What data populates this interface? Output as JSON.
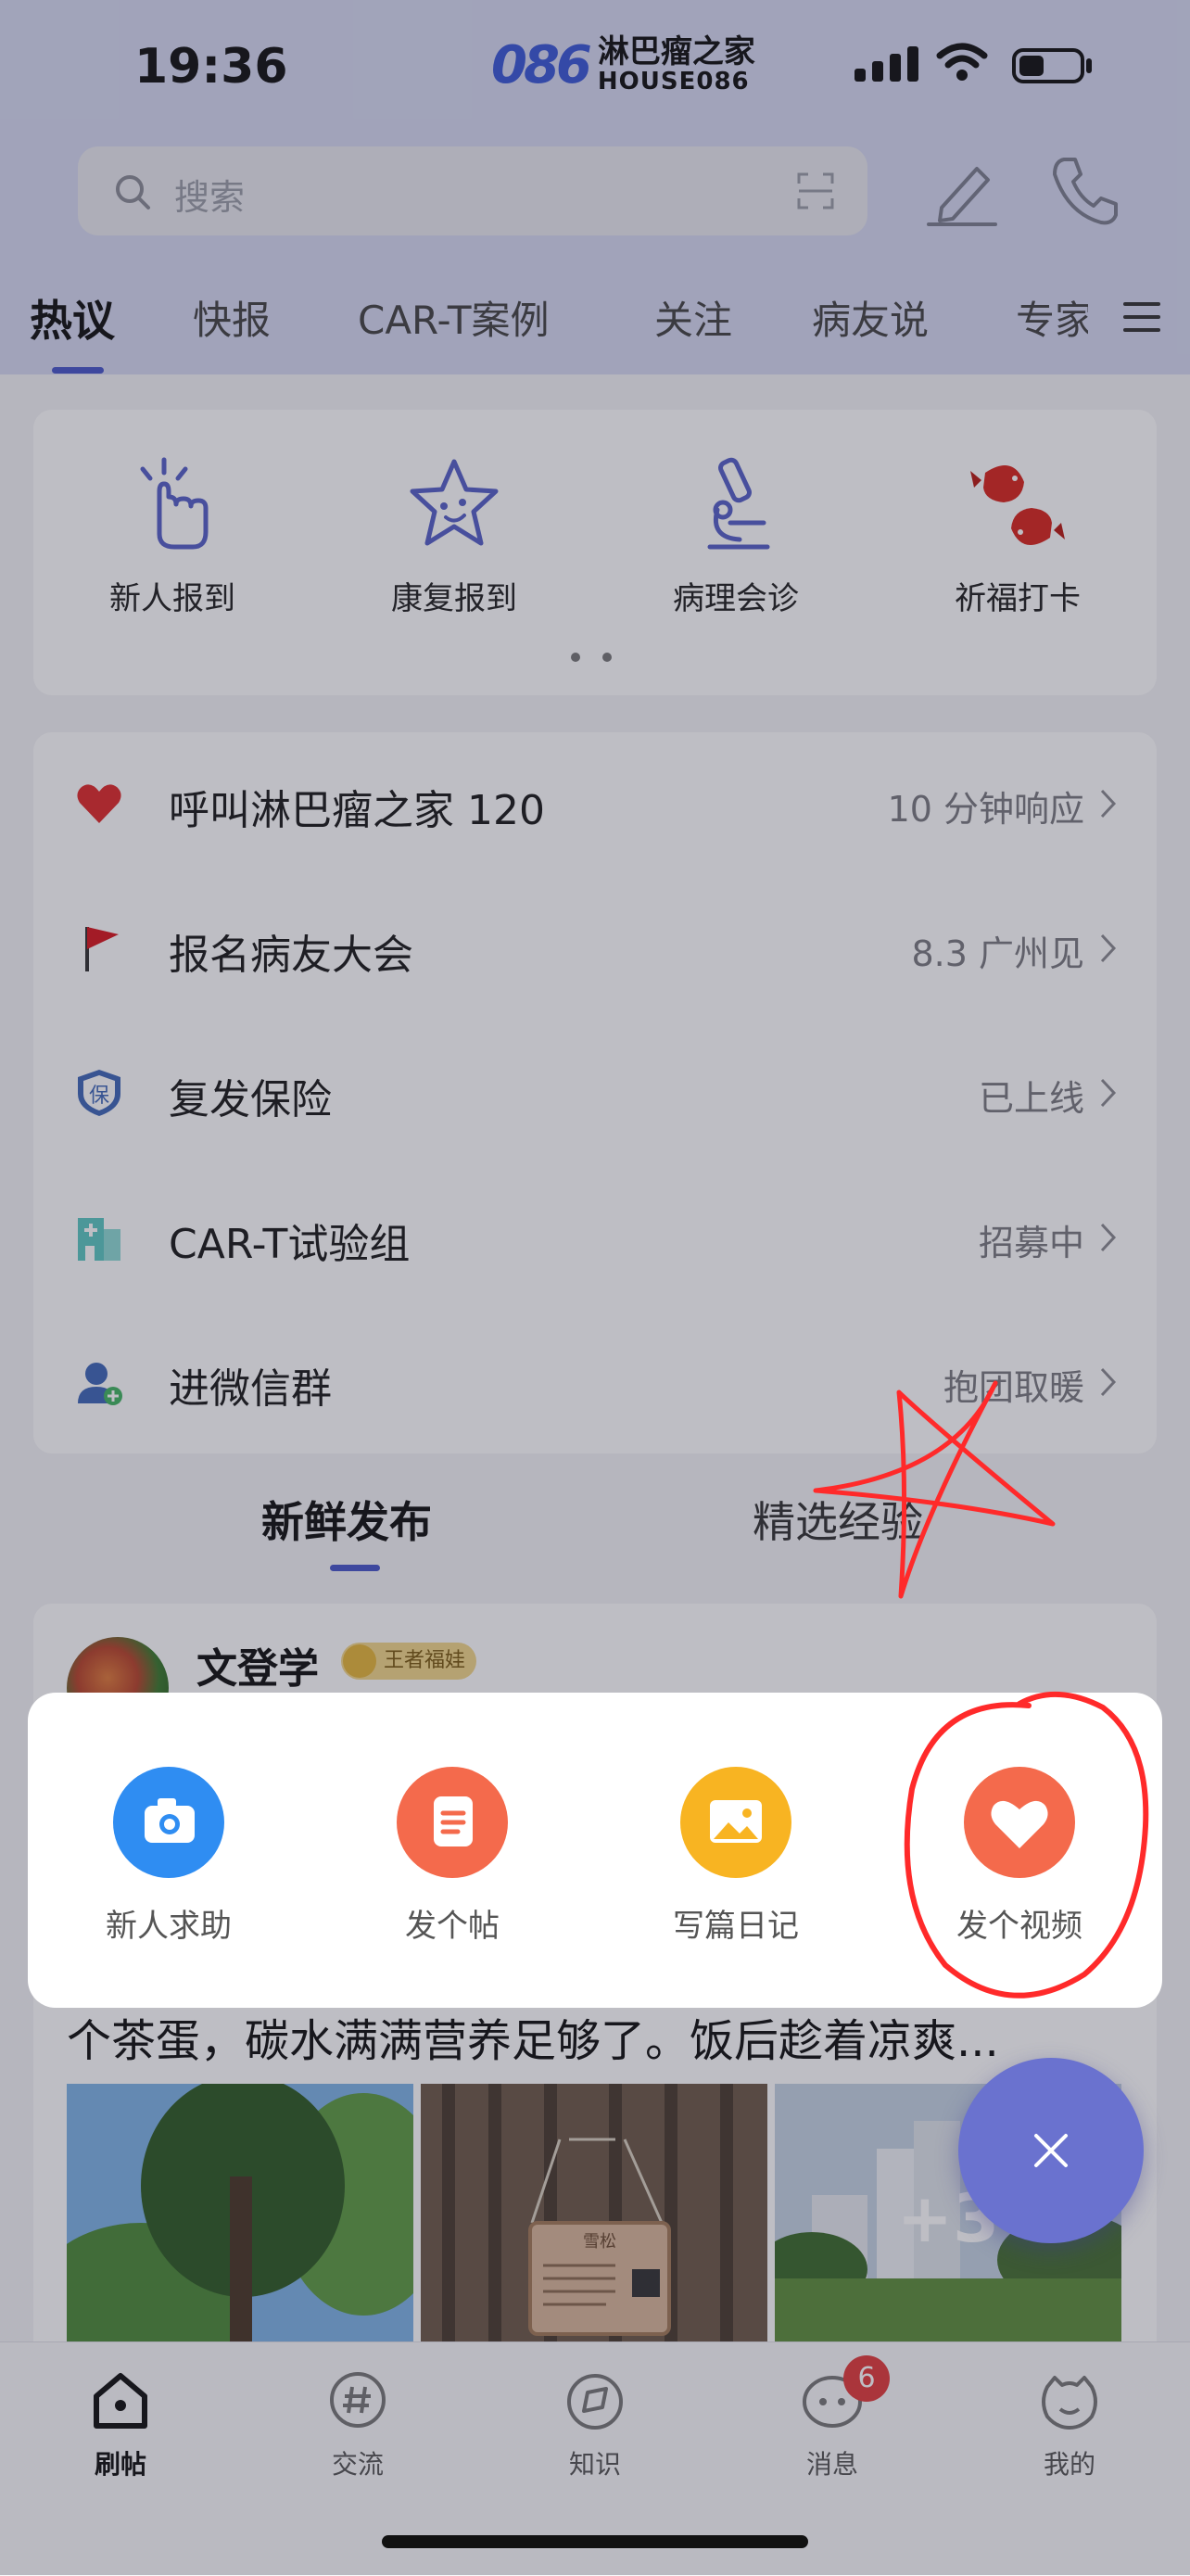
{
  "status_bar": {
    "time": "19:36"
  },
  "brand": {
    "mark": "086",
    "name_cn": "淋巴瘤之家",
    "name_en": "HOUSE086"
  },
  "search": {
    "placeholder": "搜索"
  },
  "tabs": [
    {
      "label": "热议",
      "active": true
    },
    {
      "label": "快报"
    },
    {
      "label": "CAR-T案例"
    },
    {
      "label": "关注"
    },
    {
      "label": "病友说"
    },
    {
      "label": "专家"
    }
  ],
  "quick_entries": [
    {
      "label": "新人报到",
      "icon": "pointing-hand-icon"
    },
    {
      "label": "康复报到",
      "icon": "star-face-icon"
    },
    {
      "label": "病理会诊",
      "icon": "microscope-icon"
    },
    {
      "label": "祈福打卡",
      "icon": "koi-fish-icon"
    }
  ],
  "services": [
    {
      "title": "呼叫淋巴瘤之家 120",
      "value": "10 分钟响应",
      "icon": "heart-icon"
    },
    {
      "title": "报名病友大会",
      "value": "8.3 广州见",
      "icon": "flag-icon"
    },
    {
      "title": "复发保险",
      "value": "已上线",
      "icon": "shield-icon",
      "icon_text": "保"
    },
    {
      "title": "CAR-T试验组",
      "value": "招募中",
      "icon": "hospital-icon"
    },
    {
      "title": "进微信群",
      "value": "抱团取暖",
      "icon": "group-icon"
    }
  ],
  "subtabs": [
    {
      "label": "新鲜发布",
      "active": true
    },
    {
      "label": "精选经验"
    }
  ],
  "post": {
    "author": "文登学",
    "badge": "王者福娃",
    "text": "个茶蛋，碳水满满营养足够了。饭后趁着凉爽...",
    "more_images": "+3",
    "sign_text": "雪松"
  },
  "action_sheet": [
    {
      "label": "新人求助",
      "icon": "camera-icon",
      "color": "#2f8df2"
    },
    {
      "label": "发个帖",
      "icon": "document-icon",
      "color": "#f46a4c"
    },
    {
      "label": "写篇日记",
      "icon": "image-icon",
      "color": "#f8b422"
    },
    {
      "label": "发个视频",
      "icon": "heart-icon",
      "color": "#f46a4c"
    }
  ],
  "bottom_nav": [
    {
      "label": "刷帖",
      "icon": "home-icon",
      "active": true
    },
    {
      "label": "交流",
      "icon": "hashtag-icon"
    },
    {
      "label": "知识",
      "icon": "compass-icon"
    },
    {
      "label": "消息",
      "icon": "chat-face-icon",
      "badge": "6"
    },
    {
      "label": "我的",
      "icon": "profile-face-icon"
    }
  ],
  "colors": {
    "accent": "#4856c9",
    "header_bg": "#d6d9f1",
    "fab": "#6a72cf",
    "annotation": "#ff2a2a"
  }
}
